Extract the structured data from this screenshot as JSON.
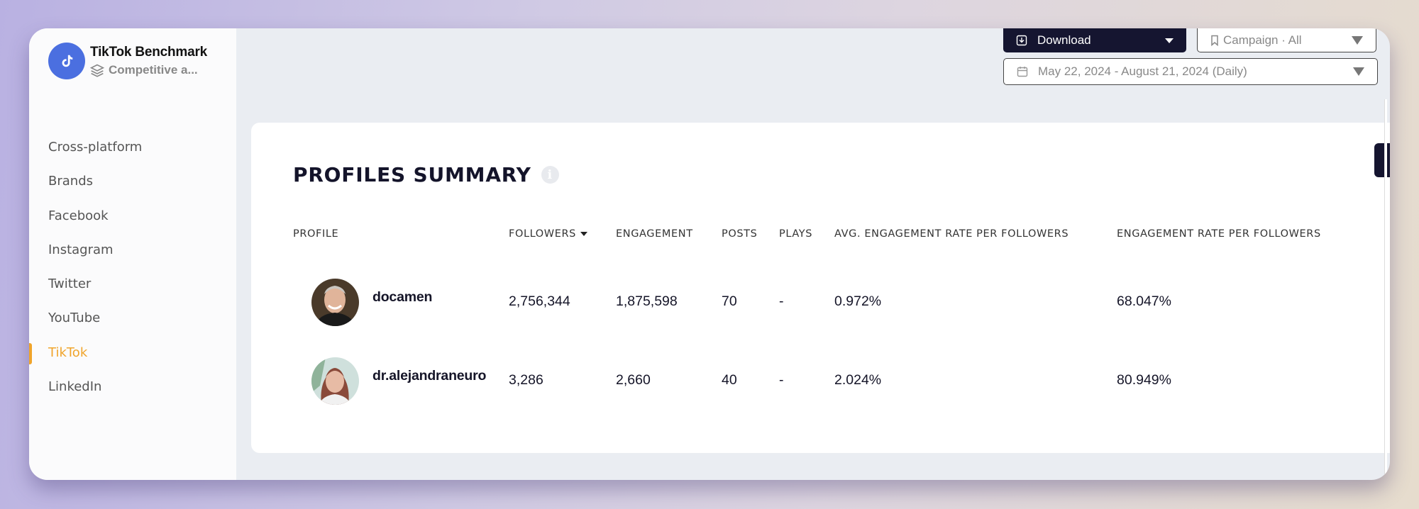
{
  "brand": {
    "title": "TikTok Benchmark",
    "subtitle": "Competitive a...",
    "logo_icon": "tiktok-icon",
    "subtitle_icon": "layers-icon",
    "accent": "#4b6fe0"
  },
  "sidebar": {
    "active_color": "#f0a42b",
    "items": [
      {
        "label": "Cross-platform",
        "active": false
      },
      {
        "label": "Brands",
        "active": false
      },
      {
        "label": "Facebook",
        "active": false
      },
      {
        "label": "Instagram",
        "active": false
      },
      {
        "label": "Twitter",
        "active": false
      },
      {
        "label": "YouTube",
        "active": false
      },
      {
        "label": "TikTok",
        "active": true
      },
      {
        "label": "LinkedIn",
        "active": false
      }
    ]
  },
  "toolbar": {
    "download_label": "Download",
    "download_icon": "download-icon",
    "campaign_label": "Campaign · All",
    "campaign_icon": "bookmark-icon",
    "date_range_label": "May 22, 2024 - August 21, 2024 (Daily)",
    "date_icon": "calendar-icon"
  },
  "summary": {
    "title": "PROFILES SUMMARY",
    "info_icon": "info-icon",
    "columns": [
      "PROFILE",
      "FOLLOWERS",
      "ENGAGEMENT",
      "POSTS",
      "PLAYS",
      "AVG. ENGAGEMENT RATE PER FOLLOWERS",
      "ENGAGEMENT RATE PER FOLLOWERS"
    ],
    "sorted_column": "FOLLOWERS",
    "sort_direction": "descending",
    "rows": [
      {
        "profile": "docamen",
        "followers": "2,756,344",
        "engagement": "1,875,598",
        "posts": "70",
        "plays": "-",
        "avg_engagement_rate": "0.972%",
        "engagement_rate": "68.047%"
      },
      {
        "profile": "dr.alejandraneuro",
        "followers": "3,286",
        "engagement": "2,660",
        "posts": "40",
        "plays": "-",
        "avg_engagement_rate": "2.024%",
        "engagement_rate": "80.949%"
      }
    ]
  }
}
